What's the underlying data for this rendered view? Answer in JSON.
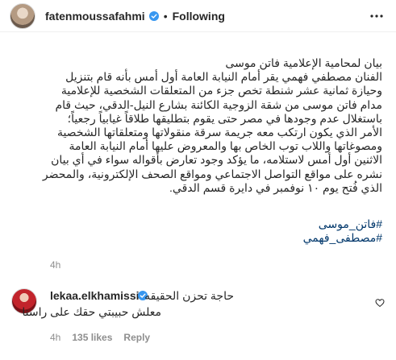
{
  "post": {
    "username": "fatenmoussafahmi",
    "separator": "•",
    "follow_status": "Following",
    "caption_lines": [
      "بيان لمحامية الإعلامية فاتن موسى",
      "الفنان مصطفي فهمي يقر أمام النيابة العامة أول أمس بأنه قام بتنزيل",
      "وحيازة ثمانية عشر شنطة تخص جزء من المتعلقات الشخصية للإعلامية",
      "مدام فاتن موسى من شقة الزوجية الكائنة بشارع النيل-الدقي، حيث  قام",
      "باستغلال عدم وجودها في مصر حتى يقوم بتطليقها طلاقاً غيابياً رجعياً؛",
      "الأمر الذي يكون ارتكب معه جريمة سرقة منقولاتها ومتعلقاتها الشخصية",
      "ومصوغاتها واللاب توب الخاص بها والمعروض عليها أمام النيابة العامة",
      "الاثنين أول أمس لاستلامه، ما يؤكد وجود تعارض بأقواله سواء في أي بيان",
      "نشره على مواقع التواصل الاجتماعي ومواقع الصحف الإلكترونية، والمحضر",
      "الذي فُتح يوم ١٠ نوفمبر في دايرة قسم الدقي."
    ],
    "hashtags": [
      "#فاتن_موسى",
      "#مصطفى_فهمي"
    ],
    "time": "4h"
  },
  "comment": {
    "username": "lekaa.elkhamissi",
    "line1": "حاجة تحزن الحقيقه",
    "line2": "معلش حبيبتي حقك على راسنا",
    "time": "4h",
    "likes": "135 likes",
    "reply": "Reply"
  },
  "colors": {
    "verified_badge": "#3897f0",
    "hashtag_link": "#00376b",
    "meta_gray": "#8e8e8e"
  },
  "icons": [
    "verified-badge-icon",
    "more-options-icon",
    "heart-icon"
  ]
}
